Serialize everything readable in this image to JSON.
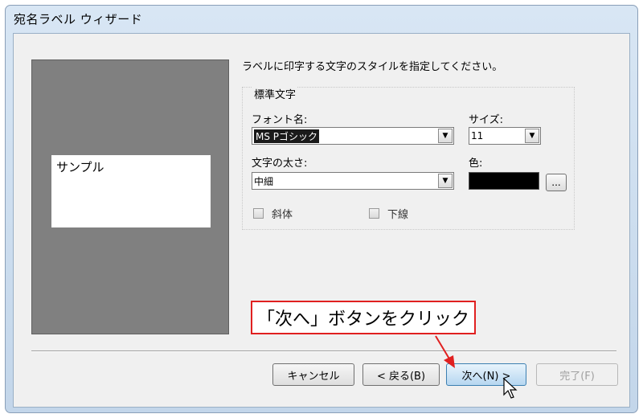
{
  "window": {
    "title": "宛名ラベル ウィザード"
  },
  "preview": {
    "sample_text": "サンプル"
  },
  "instruction": "ラベルに印字する文字のスタイルを指定してください。",
  "group": {
    "label": "標準文字",
    "font_name_label": "フォント名:",
    "font_name_value": "MS Pゴシック",
    "size_label": "サイズ:",
    "size_value": "11",
    "weight_label": "文字の太さ:",
    "weight_value": "中細",
    "color_label": "色:",
    "color_value": "#000000",
    "color_button_label": "...",
    "italic_label": "斜体",
    "underline_label": "下線"
  },
  "buttons": {
    "cancel": "キャンセル",
    "back": "< 戻る(B)",
    "next": "次へ(N) >",
    "finish": "完了(F)"
  },
  "annotation": {
    "callout_text": "「次へ」ボタンをクリック",
    "color": "#e02020"
  }
}
